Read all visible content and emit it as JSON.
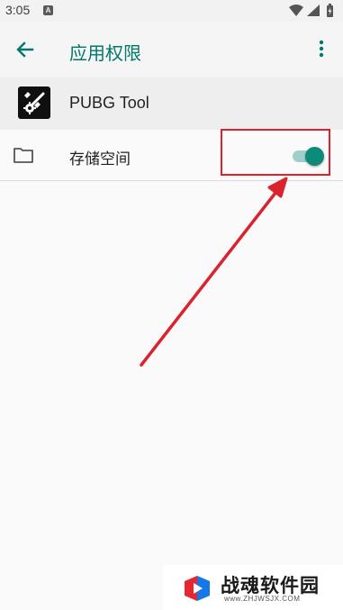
{
  "status_bar": {
    "time": "3:05",
    "notification_letter": "A",
    "icons": [
      "wifi-icon",
      "signal-icon",
      "battery-icon"
    ]
  },
  "app_bar": {
    "title": "应用权限",
    "back_icon": "arrow-left-icon",
    "menu_icon": "more-vert-icon"
  },
  "app_info": {
    "name": "PUBG Tool",
    "icon": "wrench-gear-icon"
  },
  "permissions": [
    {
      "label": "存储空间",
      "icon": "folder-icon",
      "enabled": true
    }
  ],
  "colors": {
    "accent": "#00796b",
    "toggle_thumb": "#0d8a78",
    "toggle_track": "#9fcfc8",
    "annotation": "#d9232e"
  },
  "watermark": {
    "title": "战魂软件园",
    "url": "www.ZHJWSJX.COM"
  }
}
